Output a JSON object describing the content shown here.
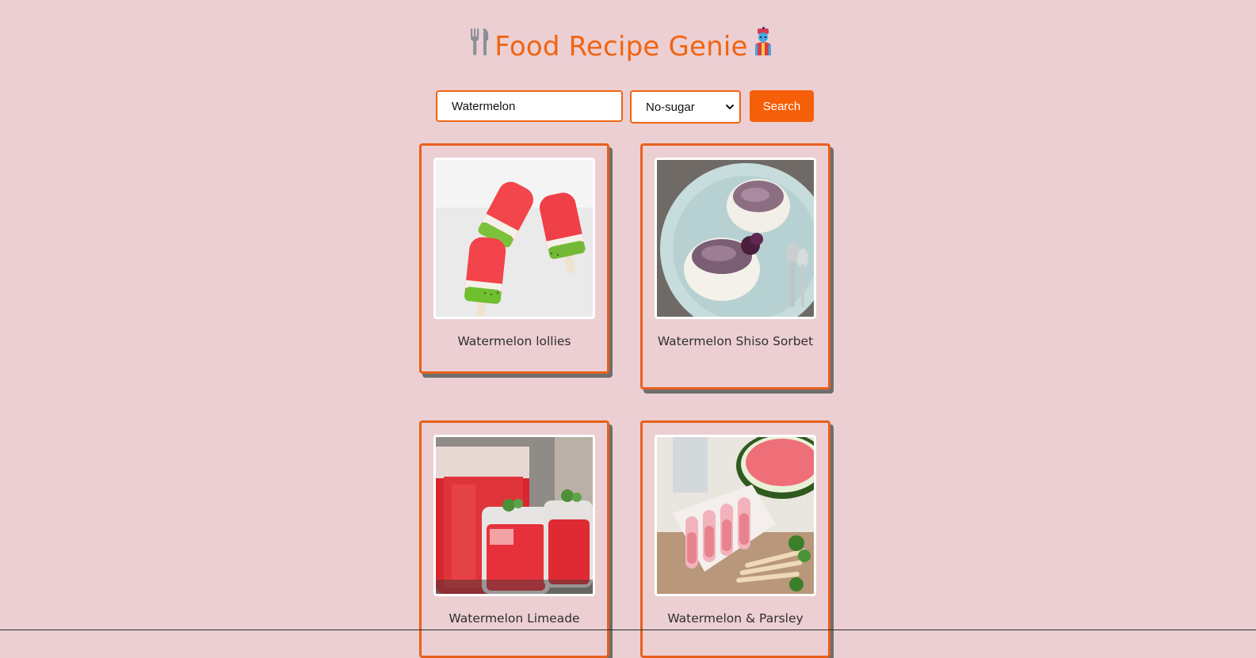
{
  "header": {
    "title": "Food Recipe Genie",
    "left_icon": "fork-and-knife-icon",
    "right_icon": "genie-icon"
  },
  "search": {
    "value": "Watermelon",
    "diet_selected": "No-sugar",
    "button_label": "Search"
  },
  "colors": {
    "background": "#eccfd2",
    "accent": "#f06412",
    "button": "#f65f0a"
  },
  "recipes": [
    {
      "title": "Watermelon lollies",
      "image": "watermelon-popsicles-photo"
    },
    {
      "title": "Watermelon Shiso Sorbet",
      "image": "purple-sorbet-cups-photo"
    },
    {
      "title": "Watermelon Limeade",
      "image": "watermelon-drink-glasses-photo"
    },
    {
      "title": "Watermelon & Parsley",
      "image": "popsicle-mold-watermelon-photo"
    }
  ]
}
